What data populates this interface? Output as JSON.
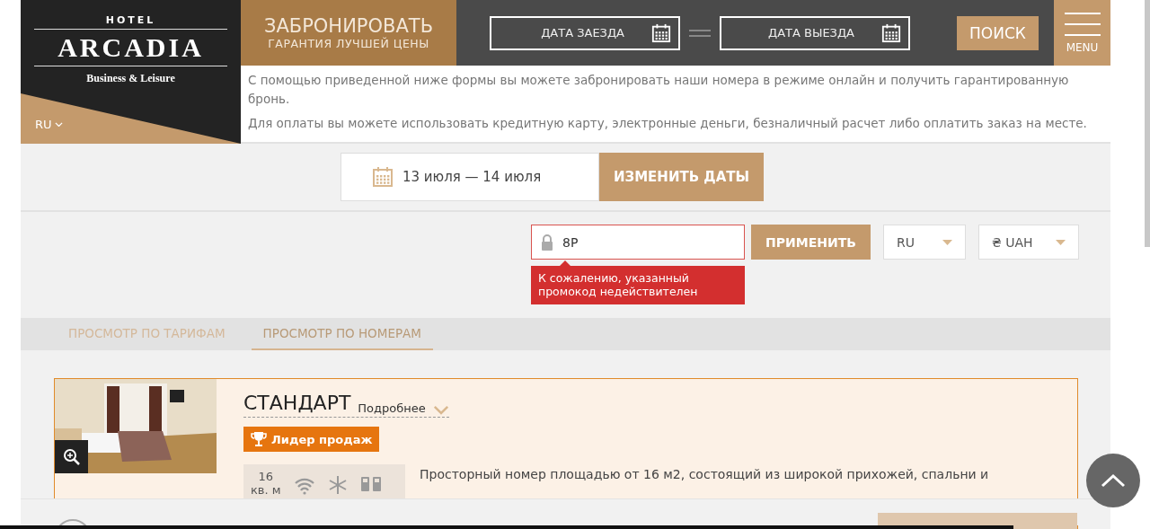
{
  "logo": {
    "hotel": "HOTEL",
    "name": "ARCADIA",
    "tagline": "Business & Leisure",
    "language": "RU",
    "expanded": false
  },
  "book": {
    "title": "ЗАБРОНИРОВАТЬ",
    "subtitle": "ГАРАНТИЯ ЛУЧШЕЙ ЦЕНЫ"
  },
  "search_bar": {
    "checkin": "ДАТА ЗАЕЗДА",
    "checkout": "ДАТА ВЫЕЗДА",
    "button": "ПОИСК",
    "menu": "MENU"
  },
  "intro": [
    "С помощью приведенной ниже формы вы можете забронировать наши номера в режиме онлайн и получить гарантированную бронь.",
    "Для оплаты вы можете использовать кредитную карту, электронные деньги, безналичный расчет либо оплатить заказ на месте."
  ],
  "dates": {
    "range": "13 июля — 14 июля",
    "button": "ИЗМЕНИТЬ ДАТЫ"
  },
  "promo": {
    "value": "8P",
    "error": "К сожалению, указанный промокод недействителен",
    "button": "ПРИМЕНИТЬ",
    "invalid": true
  },
  "selects": [
    {
      "label": "RU",
      "kind": "language"
    },
    {
      "label": "₴ UAH",
      "kind": "currency"
    }
  ],
  "tabs": [
    {
      "label": "ПРОСМОТР ПО ТАРИФАМ",
      "selected": false
    },
    {
      "label": "ПРОСМОТР ПО НОМЕРАМ",
      "selected": true
    }
  ],
  "room": {
    "name": "СТАНДАРТ",
    "more": "Подробнее",
    "badge": "Лидер продаж",
    "area": "16",
    "area_unit": "кв. м",
    "description": "Просторный номер площадью от 16 м2, состоящий из широкой прихожей, спальни и"
  }
}
